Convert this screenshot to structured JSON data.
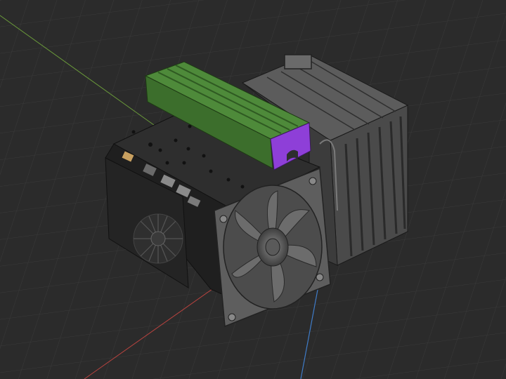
{
  "viewport": {
    "background": "#2b2b2b",
    "grid_color": "#3a3a3a",
    "axes": {
      "x_color": "#b8433f",
      "y_color": "#6a9a3a",
      "z_color": "#3f7cc8"
    }
  },
  "model": {
    "parts": [
      {
        "name": "radiator-heatsink",
        "color": "#5a5a5a"
      },
      {
        "name": "ssd-heatsink",
        "color": "#4e8a3a"
      },
      {
        "name": "heatsink-bracket",
        "color": "#8e3fd8"
      },
      {
        "name": "case-fan-120mm",
        "color": "#6a6a6a"
      },
      {
        "name": "motherboard-io-panel",
        "color": "#222222"
      },
      {
        "name": "blower-fan",
        "color": "#3a3a3a"
      }
    ]
  }
}
